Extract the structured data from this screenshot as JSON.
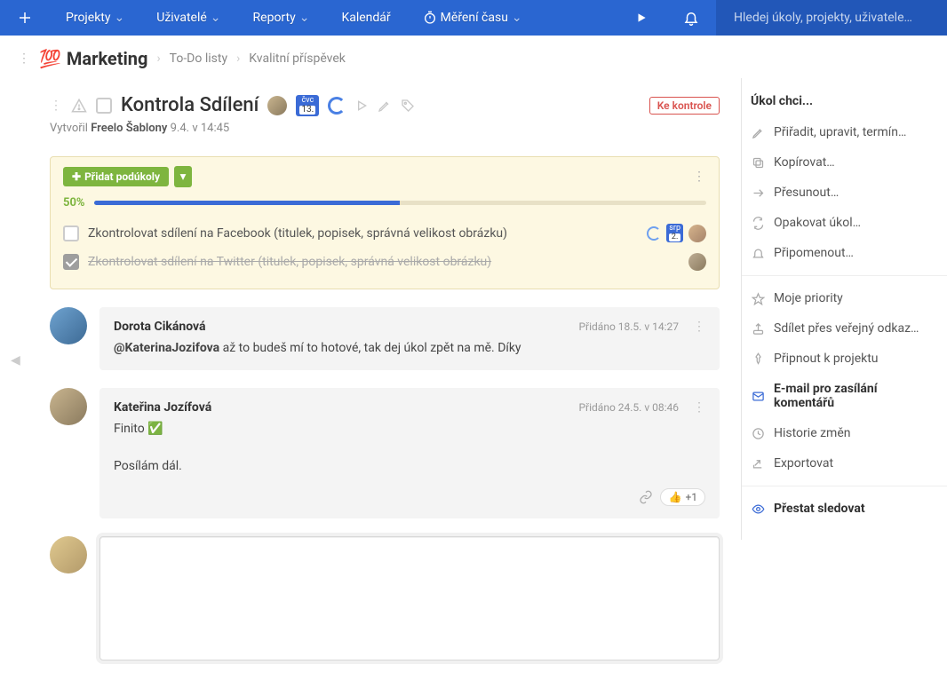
{
  "nav": {
    "items": [
      "Projekty",
      "Uživatelé",
      "Reporty",
      "Kalendář",
      "Měření času"
    ],
    "search_placeholder": "Hledej úkoly, projekty, uživatele…"
  },
  "breadcrumb": {
    "emoji": "💯",
    "project": "Marketing",
    "list": "To-Do listy",
    "task": "Kvalitní příspěvek"
  },
  "task": {
    "title": "Kontrola Sdílení",
    "badge_month": "čvc",
    "badge_day": "13.",
    "status": "Ke kontrole",
    "created_prefix": "Vytvořil",
    "created_by": "Freelo Šablony",
    "created_at": "9.4. v 14:45"
  },
  "subtasks": {
    "add_label": "Přidat podúkoly",
    "progress_pct": "50%",
    "progress_value": 50,
    "items": [
      {
        "done": false,
        "label": "Zkontrolovat sdílení na Facebook (titulek, popisek, správná velikost obrázku)",
        "badge_m": "srp",
        "badge_d": "2."
      },
      {
        "done": true,
        "label": "Zkontrolovat sdílení na Twitter (titulek, popisek, správná velikost obrázku)"
      }
    ]
  },
  "comments": [
    {
      "author": "Dorota Cikánová",
      "meta": "Přidáno 18.5. v 14:27",
      "mention": "@KaterinaJozifova",
      "text": " až to budeš mí to hotové, tak dej úkol zpět na mě. Díky"
    },
    {
      "author": "Kateřina Jozífová",
      "meta": "Přidáno 24.5. v 08:46",
      "line1": "Finito ✅",
      "line2": "Posílám dál.",
      "likes": "+1"
    }
  ],
  "sidebar": {
    "title": "Úkol chci...",
    "groups": [
      [
        {
          "icon": "pencil",
          "label": "Přiřadit, upravit, termín…"
        },
        {
          "icon": "copy",
          "label": "Kopírovat…"
        },
        {
          "icon": "move",
          "label": "Přesunout…"
        },
        {
          "icon": "repeat",
          "label": "Opakovat úkol…"
        },
        {
          "icon": "bell",
          "label": "Připomenout…"
        }
      ],
      [
        {
          "icon": "star",
          "label": "Moje priority"
        },
        {
          "icon": "share",
          "label": "Sdílet přes veřejný odkaz…"
        },
        {
          "icon": "pin",
          "label": "Připnout k projektu"
        },
        {
          "icon": "mail",
          "label": "E-mail pro zasílání komentářů",
          "bold": true
        },
        {
          "icon": "history",
          "label": "Historie změn"
        },
        {
          "icon": "export",
          "label": "Exportovat"
        }
      ],
      [
        {
          "icon": "eye",
          "label": "Přestat sledovat",
          "bold": true
        }
      ]
    ]
  }
}
